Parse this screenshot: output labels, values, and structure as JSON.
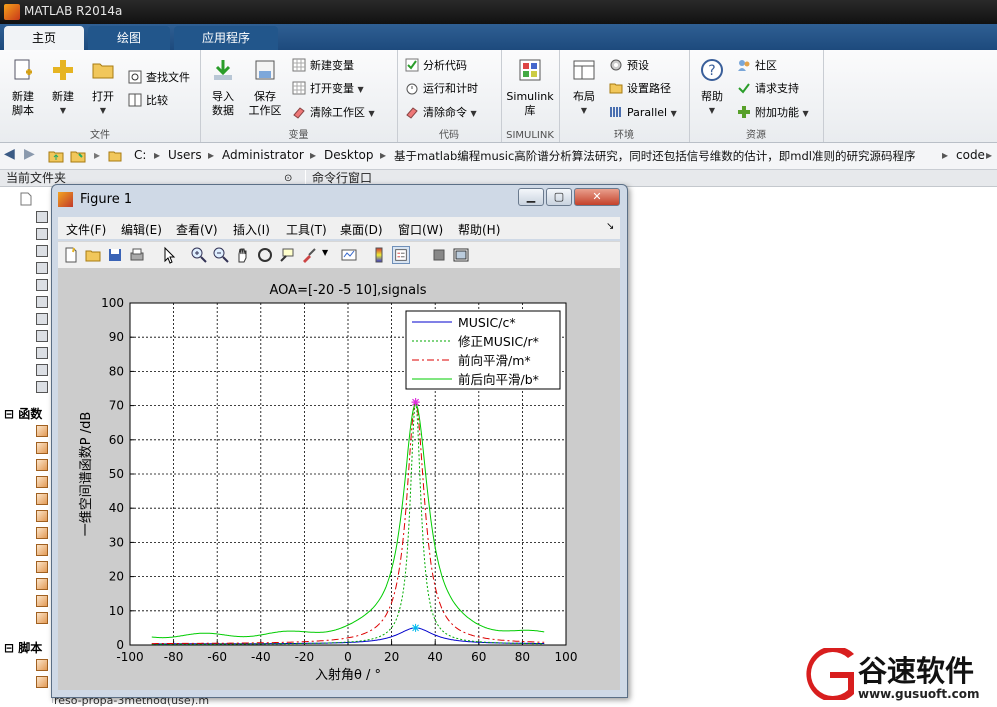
{
  "window": {
    "title": "MATLAB R2014a"
  },
  "tabs": [
    {
      "label": "主页",
      "active": true
    },
    {
      "label": "绘图",
      "active": false
    },
    {
      "label": "应用程序",
      "active": false
    }
  ],
  "ribbon": {
    "file_group": {
      "label": "文件",
      "new_script_l1": "新建",
      "new_script_l2": "脚本",
      "new": "新建",
      "open": "打开",
      "find_files": "查找文件",
      "compare": "比较"
    },
    "variable_group": {
      "label": "变量",
      "import_l1": "导入",
      "import_l2": "数据",
      "save_l1": "保存",
      "save_l2": "工作区",
      "new_var": "新建变量",
      "open_var": "打开变量",
      "clear_ws": "清除工作区"
    },
    "code_group": {
      "label": "代码",
      "analyze": "分析代码",
      "run_time": "运行和计时",
      "clear_cmd": "清除命令"
    },
    "simulink_group": {
      "label": "SIMULINK",
      "simulink_l1": "Simulink",
      "simulink_l2": "库"
    },
    "env_group": {
      "label": "环境",
      "layout": "布局",
      "prefs": "预设",
      "set_path": "设置路径",
      "parallel": "Parallel"
    },
    "resources_group": {
      "label": "资源",
      "help": "帮助",
      "community": "社区",
      "request_support": "请求支持",
      "addons": "附加功能"
    }
  },
  "address": {
    "crumbs": [
      "C:",
      "Users",
      "Administrator",
      "Desktop",
      "基于matlab编程music高阶谱分析算法研究，同时还包括信号维数的估计，即mdl准则的研究源码程序",
      "code"
    ]
  },
  "panels": {
    "current_folder": "当前文件夹",
    "command_window": "命令行窗口",
    "functions": "函数",
    "scripts": "脚本",
    "file_bottom": "reso-propa-3method(use).m"
  },
  "figure": {
    "title": "Figure 1",
    "menu": [
      "文件(F)",
      "编辑(E)",
      "查看(V)",
      "插入(I)",
      "工具(T)",
      "桌面(D)",
      "窗口(W)",
      "帮助(H)"
    ]
  },
  "chart_data": {
    "type": "line",
    "title": "AOA=[-20  -5  10],signals",
    "xlabel": "入射角θ / °",
    "ylabel": "一维空间谱函数P /dB",
    "xlim": [
      -100,
      100
    ],
    "ylim": [
      0,
      100
    ],
    "xticks": [
      -100,
      -80,
      -60,
      -40,
      -20,
      0,
      20,
      40,
      60,
      80,
      100
    ],
    "yticks": [
      0,
      10,
      20,
      30,
      40,
      50,
      60,
      70,
      80,
      90,
      100
    ],
    "grid": true,
    "legend_position": "top-right",
    "peak_x": 31,
    "series": [
      {
        "name": "MUSIC/c*",
        "color": "#0000cc",
        "style": "solid",
        "peak": 5,
        "base": 0.3,
        "width": 10
      },
      {
        "name": "修正MUSIC/r*",
        "color": "#00aa00",
        "style": "dotted",
        "peak": 71,
        "base": 0.2,
        "width": 3
      },
      {
        "name": "前向平滑/m*",
        "color": "#dd0000",
        "style": "dashdot",
        "peak": 71,
        "base": 0.3,
        "width": 5
      },
      {
        "name": "前后向平滑/b*",
        "color": "#00cc00",
        "style": "solid",
        "peak": 71,
        "base": 2.5,
        "width": 7
      }
    ]
  },
  "watermark": {
    "brand": "谷速软件",
    "url": "www.gusuoft.com"
  },
  "colors": {
    "accent": "#1d4a7d",
    "ribbon_bg": "#eef0f3",
    "figure_frame": "#cfd9e6"
  }
}
